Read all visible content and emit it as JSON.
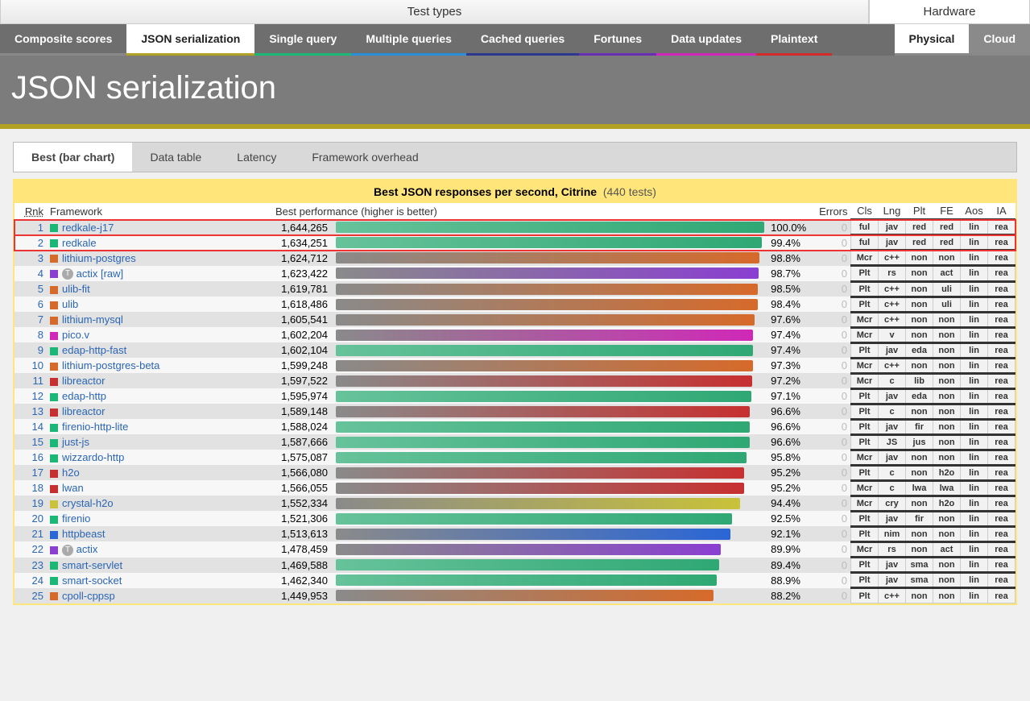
{
  "header": {
    "left": "Test types",
    "right": "Hardware"
  },
  "tabs": [
    {
      "label": "Composite scores",
      "cls": "c-comp"
    },
    {
      "label": "JSON serialization",
      "cls": "c-json",
      "active": true
    },
    {
      "label": "Single query",
      "cls": "c-sq"
    },
    {
      "label": "Multiple queries",
      "cls": "c-mq"
    },
    {
      "label": "Cached queries",
      "cls": "c-cq"
    },
    {
      "label": "Fortunes",
      "cls": "c-for"
    },
    {
      "label": "Data updates",
      "cls": "c-du"
    },
    {
      "label": "Plaintext",
      "cls": "c-pt"
    }
  ],
  "hwtabs": [
    {
      "label": "Physical",
      "active": true
    },
    {
      "label": "Cloud"
    }
  ],
  "title": "JSON serialization",
  "subtabs": [
    "Best (bar chart)",
    "Data table",
    "Latency",
    "Framework overhead"
  ],
  "subtab_active": 0,
  "chart_title_bold": "Best JSON responses per second, Citrine",
  "chart_title_count": "(440 tests)",
  "columns": {
    "rnk": "Rnk",
    "fw": "Framework",
    "perf": "Best performance (higher is better)",
    "err": "Errors",
    "cls": "Cls",
    "lng": "Lng",
    "plt": "Plt",
    "fe": "FE",
    "aos": "Aos",
    "ia": "IA"
  },
  "chart_data": {
    "type": "bar",
    "xlabel": "",
    "ylabel": "Responses per second",
    "title": "Best JSON responses per second, Citrine",
    "ylim": [
      0,
      1644265
    ],
    "categories": [
      "redkale-j17",
      "redkale",
      "lithium-postgres",
      "actix [raw]",
      "ulib-fit",
      "ulib",
      "lithium-mysql",
      "pico.v",
      "edap-http-fast",
      "lithium-postgres-beta",
      "libreactor",
      "edap-http",
      "libreactor",
      "firenio-http-lite",
      "just-js",
      "wizzardo-http",
      "h2o",
      "lwan",
      "crystal-h2o",
      "firenio",
      "httpbeast",
      "actix",
      "smart-servlet",
      "smart-socket",
      "cpoll-cppsp"
    ],
    "values": [
      1644265,
      1634251,
      1624712,
      1623422,
      1619781,
      1618486,
      1605541,
      1602204,
      1602104,
      1599248,
      1597522,
      1595974,
      1589148,
      1588024,
      1587666,
      1575087,
      1566080,
      1566055,
      1552334,
      1521306,
      1513613,
      1478459,
      1469588,
      1462340,
      1449953
    ],
    "pct": [
      100.0,
      99.4,
      98.8,
      98.7,
      98.5,
      98.4,
      97.6,
      97.4,
      97.4,
      97.3,
      97.2,
      97.1,
      96.6,
      96.6,
      96.6,
      95.8,
      95.2,
      95.2,
      94.4,
      92.5,
      92.1,
      89.9,
      89.4,
      88.9,
      88.2
    ]
  },
  "rows": [
    {
      "rnk": 1,
      "name": "redkale-j17",
      "sq": "#1bb776",
      "bar": "linear-gradient(90deg,#66c29a,#2fa874)",
      "pct": "100.0%",
      "perf": "1,644,265",
      "err": 0,
      "hl": true,
      "tags": [
        [
          "ful",
          "tc-ful"
        ],
        [
          "jav",
          "tc-jav"
        ],
        [
          "red",
          "tc-red"
        ],
        [
          "red",
          "tc-red"
        ],
        [
          "lin",
          "tc-lin"
        ],
        [
          "rea",
          "tc-rea"
        ]
      ]
    },
    {
      "rnk": 2,
      "name": "redkale",
      "sq": "#1bb776",
      "bar": "linear-gradient(90deg,#66c29a,#2fa874)",
      "pct": "99.4%",
      "perf": "1,634,251",
      "err": 0,
      "hl": true,
      "tags": [
        [
          "ful",
          "tc-ful"
        ],
        [
          "jav",
          "tc-jav"
        ],
        [
          "red",
          "tc-red"
        ],
        [
          "red",
          "tc-red"
        ],
        [
          "lin",
          "tc-lin"
        ],
        [
          "rea",
          "tc-rea"
        ]
      ]
    },
    {
      "rnk": 3,
      "name": "lithium-postgres",
      "sq": "#d66a2a",
      "bar": "linear-gradient(90deg,#8a8a8a,#d66a2a)",
      "pct": "98.8%",
      "perf": "1,624,712",
      "err": 0,
      "tags": [
        [
          "Mcr",
          "tc-mcr"
        ],
        [
          "c++",
          "tc-cpp"
        ],
        [
          "non",
          "tc-non"
        ],
        [
          "non",
          "tc-non"
        ],
        [
          "lin",
          "tc-lin"
        ],
        [
          "rea",
          "tc-rea"
        ]
      ]
    },
    {
      "rnk": 4,
      "name": "actix [raw]",
      "sq": "#8a3fd1",
      "gear": true,
      "bar": "linear-gradient(90deg,#8a8a8a,#8a3fd1)",
      "pct": "98.7%",
      "perf": "1,623,422",
      "err": 0,
      "tags": [
        [
          "Plt",
          "tc-plt"
        ],
        [
          "rs",
          "tc-rs"
        ],
        [
          "non",
          "tc-non"
        ],
        [
          "act",
          "tc-act"
        ],
        [
          "lin",
          "tc-lin"
        ],
        [
          "rea",
          "tc-rea"
        ]
      ]
    },
    {
      "rnk": 5,
      "name": "ulib-fit",
      "sq": "#d66a2a",
      "bar": "linear-gradient(90deg,#8a8a8a,#d66a2a)",
      "pct": "98.5%",
      "perf": "1,619,781",
      "err": 0,
      "tags": [
        [
          "Plt",
          "tc-plt"
        ],
        [
          "c++",
          "tc-cpp"
        ],
        [
          "non",
          "tc-non"
        ],
        [
          "uli",
          "tc-uli"
        ],
        [
          "lin",
          "tc-lin"
        ],
        [
          "rea",
          "tc-rea"
        ]
      ]
    },
    {
      "rnk": 6,
      "name": "ulib",
      "sq": "#d66a2a",
      "bar": "linear-gradient(90deg,#8a8a8a,#d66a2a)",
      "pct": "98.4%",
      "perf": "1,618,486",
      "err": 0,
      "tags": [
        [
          "Plt",
          "tc-plt"
        ],
        [
          "c++",
          "tc-cpp"
        ],
        [
          "non",
          "tc-non"
        ],
        [
          "uli",
          "tc-uli"
        ],
        [
          "lin",
          "tc-lin"
        ],
        [
          "rea",
          "tc-rea"
        ]
      ]
    },
    {
      "rnk": 7,
      "name": "lithium-mysql",
      "sq": "#d66a2a",
      "bar": "linear-gradient(90deg,#8a8a8a,#d66a2a)",
      "pct": "97.6%",
      "perf": "1,605,541",
      "err": 0,
      "tags": [
        [
          "Mcr",
          "tc-mcr"
        ],
        [
          "c++",
          "tc-cpp"
        ],
        [
          "non",
          "tc-non"
        ],
        [
          "non",
          "tc-non"
        ],
        [
          "lin",
          "tc-lin"
        ],
        [
          "rea",
          "tc-rea"
        ]
      ]
    },
    {
      "rnk": 8,
      "name": "pico.v",
      "sq": "#d028b8",
      "bar": "linear-gradient(90deg,#8a8a8a,#d028b8)",
      "pct": "97.4%",
      "perf": "1,602,204",
      "err": 0,
      "tags": [
        [
          "Mcr",
          "tc-mcr"
        ],
        [
          "v",
          "tc-v"
        ],
        [
          "non",
          "tc-non"
        ],
        [
          "non",
          "tc-non"
        ],
        [
          "lin",
          "tc-lin"
        ],
        [
          "rea",
          "tc-rea"
        ]
      ]
    },
    {
      "rnk": 9,
      "name": "edap-http-fast",
      "sq": "#1bb776",
      "bar": "linear-gradient(90deg,#66c29a,#2fa874)",
      "pct": "97.4%",
      "perf": "1,602,104",
      "err": 0,
      "tags": [
        [
          "Plt",
          "tc-plt"
        ],
        [
          "jav",
          "tc-jav"
        ],
        [
          "eda",
          "tc-eda"
        ],
        [
          "non",
          "tc-non"
        ],
        [
          "lin",
          "tc-lin"
        ],
        [
          "rea",
          "tc-rea"
        ]
      ]
    },
    {
      "rnk": 10,
      "name": "lithium-postgres-beta",
      "sq": "#d66a2a",
      "bar": "linear-gradient(90deg,#8a8a8a,#d66a2a)",
      "pct": "97.3%",
      "perf": "1,599,248",
      "err": 0,
      "tags": [
        [
          "Mcr",
          "tc-mcr"
        ],
        [
          "c++",
          "tc-cpp"
        ],
        [
          "non",
          "tc-non"
        ],
        [
          "non",
          "tc-non"
        ],
        [
          "lin",
          "tc-lin"
        ],
        [
          "rea",
          "tc-rea"
        ]
      ]
    },
    {
      "rnk": 11,
      "name": "libreactor",
      "sq": "#c73030",
      "bar": "linear-gradient(90deg,#8a8a8a,#c73030)",
      "pct": "97.2%",
      "perf": "1,597,522",
      "err": 0,
      "tags": [
        [
          "Mcr",
          "tc-mcr"
        ],
        [
          "c",
          "tc-c"
        ],
        [
          "lib",
          "tc-lib"
        ],
        [
          "non",
          "tc-non"
        ],
        [
          "lin",
          "tc-lin"
        ],
        [
          "rea",
          "tc-rea"
        ]
      ]
    },
    {
      "rnk": 12,
      "name": "edap-http",
      "sq": "#1bb776",
      "bar": "linear-gradient(90deg,#66c29a,#2fa874)",
      "pct": "97.1%",
      "perf": "1,595,974",
      "err": 0,
      "tags": [
        [
          "Plt",
          "tc-plt"
        ],
        [
          "jav",
          "tc-jav"
        ],
        [
          "eda",
          "tc-eda"
        ],
        [
          "non",
          "tc-non"
        ],
        [
          "lin",
          "tc-lin"
        ],
        [
          "rea",
          "tc-rea"
        ]
      ]
    },
    {
      "rnk": 13,
      "name": "libreactor",
      "sq": "#c73030",
      "bar": "linear-gradient(90deg,#8a8a8a,#c73030)",
      "pct": "96.6%",
      "perf": "1,589,148",
      "err": 0,
      "tags": [
        [
          "Plt",
          "tc-plt"
        ],
        [
          "c",
          "tc-c"
        ],
        [
          "non",
          "tc-non"
        ],
        [
          "non",
          "tc-non"
        ],
        [
          "lin",
          "tc-lin"
        ],
        [
          "rea",
          "tc-rea"
        ]
      ]
    },
    {
      "rnk": 14,
      "name": "firenio-http-lite",
      "sq": "#1bb776",
      "bar": "linear-gradient(90deg,#66c29a,#2fa874)",
      "pct": "96.6%",
      "perf": "1,588,024",
      "err": 0,
      "tags": [
        [
          "Plt",
          "tc-plt"
        ],
        [
          "jav",
          "tc-jav"
        ],
        [
          "fir",
          "tc-fir"
        ],
        [
          "non",
          "tc-non"
        ],
        [
          "lin",
          "tc-lin"
        ],
        [
          "rea",
          "tc-rea"
        ]
      ]
    },
    {
      "rnk": 15,
      "name": "just-js",
      "sq": "#1bb776",
      "bar": "linear-gradient(90deg,#66c29a,#2fa874)",
      "pct": "96.6%",
      "perf": "1,587,666",
      "err": 0,
      "tags": [
        [
          "Plt",
          "tc-plt"
        ],
        [
          "JS",
          "tc-js"
        ],
        [
          "jus",
          "tc-jus"
        ],
        [
          "non",
          "tc-non"
        ],
        [
          "lin",
          "tc-lin"
        ],
        [
          "rea",
          "tc-rea"
        ]
      ]
    },
    {
      "rnk": 16,
      "name": "wizzardo-http",
      "sq": "#1bb776",
      "bar": "linear-gradient(90deg,#66c29a,#2fa874)",
      "pct": "95.8%",
      "perf": "1,575,087",
      "err": 0,
      "tags": [
        [
          "Mcr",
          "tc-mcr"
        ],
        [
          "jav",
          "tc-jav"
        ],
        [
          "non",
          "tc-non"
        ],
        [
          "non",
          "tc-non"
        ],
        [
          "lin",
          "tc-lin"
        ],
        [
          "rea",
          "tc-rea"
        ]
      ]
    },
    {
      "rnk": 17,
      "name": "h2o",
      "sq": "#c73030",
      "bar": "linear-gradient(90deg,#8a8a8a,#c73030)",
      "pct": "95.2%",
      "perf": "1,566,080",
      "err": 0,
      "tags": [
        [
          "Plt",
          "tc-plt"
        ],
        [
          "c",
          "tc-c"
        ],
        [
          "non",
          "tc-non"
        ],
        [
          "h2o",
          "tc-h2o"
        ],
        [
          "lin",
          "tc-lin"
        ],
        [
          "rea",
          "tc-rea"
        ]
      ]
    },
    {
      "rnk": 18,
      "name": "lwan",
      "sq": "#c73030",
      "bar": "linear-gradient(90deg,#8a8a8a,#c73030)",
      "pct": "95.2%",
      "perf": "1,566,055",
      "err": 0,
      "tags": [
        [
          "Mcr",
          "tc-mcr"
        ],
        [
          "c",
          "tc-c"
        ],
        [
          "lwa",
          "tc-lwa"
        ],
        [
          "lwa",
          "tc-lwa"
        ],
        [
          "lin",
          "tc-lin"
        ],
        [
          "rea",
          "tc-rea"
        ]
      ]
    },
    {
      "rnk": 19,
      "name": "crystal-h2o",
      "sq": "#c9c23a",
      "bar": "linear-gradient(90deg,#8a8a8a,#c9c23a)",
      "pct": "94.4%",
      "perf": "1,552,334",
      "err": 0,
      "tags": [
        [
          "Mcr",
          "tc-mcr"
        ],
        [
          "cry",
          "tc-cry"
        ],
        [
          "non",
          "tc-non"
        ],
        [
          "h2o",
          "tc-h2o"
        ],
        [
          "lin",
          "tc-lin"
        ],
        [
          "rea",
          "tc-rea"
        ]
      ]
    },
    {
      "rnk": 20,
      "name": "firenio",
      "sq": "#1bb776",
      "bar": "linear-gradient(90deg,#66c29a,#2fa874)",
      "pct": "92.5%",
      "perf": "1,521,306",
      "err": 0,
      "tags": [
        [
          "Plt",
          "tc-plt"
        ],
        [
          "jav",
          "tc-jav"
        ],
        [
          "fir",
          "tc-fir"
        ],
        [
          "non",
          "tc-non"
        ],
        [
          "lin",
          "tc-lin"
        ],
        [
          "rea",
          "tc-rea"
        ]
      ]
    },
    {
      "rnk": 21,
      "name": "httpbeast",
      "sq": "#2a66d6",
      "bar": "linear-gradient(90deg,#8a8a8a,#2a66d6)",
      "pct": "92.1%",
      "perf": "1,513,613",
      "err": 0,
      "tags": [
        [
          "Plt",
          "tc-plt"
        ],
        [
          "nim",
          "tc-nim"
        ],
        [
          "non",
          "tc-non"
        ],
        [
          "non",
          "tc-non"
        ],
        [
          "lin",
          "tc-lin"
        ],
        [
          "rea",
          "tc-rea"
        ]
      ]
    },
    {
      "rnk": 22,
      "name": "actix",
      "sq": "#8a3fd1",
      "gear": true,
      "bar": "linear-gradient(90deg,#8a8a8a,#8a3fd1)",
      "pct": "89.9%",
      "perf": "1,478,459",
      "err": 0,
      "tags": [
        [
          "Mcr",
          "tc-mcr"
        ],
        [
          "rs",
          "tc-rs"
        ],
        [
          "non",
          "tc-non"
        ],
        [
          "act",
          "tc-act"
        ],
        [
          "lin",
          "tc-lin"
        ],
        [
          "rea",
          "tc-rea"
        ]
      ]
    },
    {
      "rnk": 23,
      "name": "smart-servlet",
      "sq": "#1bb776",
      "bar": "linear-gradient(90deg,#66c29a,#2fa874)",
      "pct": "89.4%",
      "perf": "1,469,588",
      "err": 0,
      "tags": [
        [
          "Plt",
          "tc-plt"
        ],
        [
          "jav",
          "tc-jav"
        ],
        [
          "sma",
          "tc-sma"
        ],
        [
          "non",
          "tc-non"
        ],
        [
          "lin",
          "tc-lin"
        ],
        [
          "rea",
          "tc-rea"
        ]
      ]
    },
    {
      "rnk": 24,
      "name": "smart-socket",
      "sq": "#1bb776",
      "bar": "linear-gradient(90deg,#66c29a,#2fa874)",
      "pct": "88.9%",
      "perf": "1,462,340",
      "err": 0,
      "tags": [
        [
          "Plt",
          "tc-plt"
        ],
        [
          "jav",
          "tc-jav"
        ],
        [
          "sma",
          "tc-sma"
        ],
        [
          "non",
          "tc-non"
        ],
        [
          "lin",
          "tc-lin"
        ],
        [
          "rea",
          "tc-rea"
        ]
      ]
    },
    {
      "rnk": 25,
      "name": "cpoll-cppsp",
      "sq": "#d66a2a",
      "bar": "linear-gradient(90deg,#8a8a8a,#d66a2a)",
      "pct": "88.2%",
      "perf": "1,449,953",
      "err": 0,
      "tags": [
        [
          "Plt",
          "tc-plt"
        ],
        [
          "c++",
          "tc-cpp"
        ],
        [
          "non",
          "tc-non"
        ],
        [
          "non",
          "tc-non"
        ],
        [
          "lin",
          "tc-lin"
        ],
        [
          "rea",
          "tc-rea"
        ]
      ]
    }
  ]
}
